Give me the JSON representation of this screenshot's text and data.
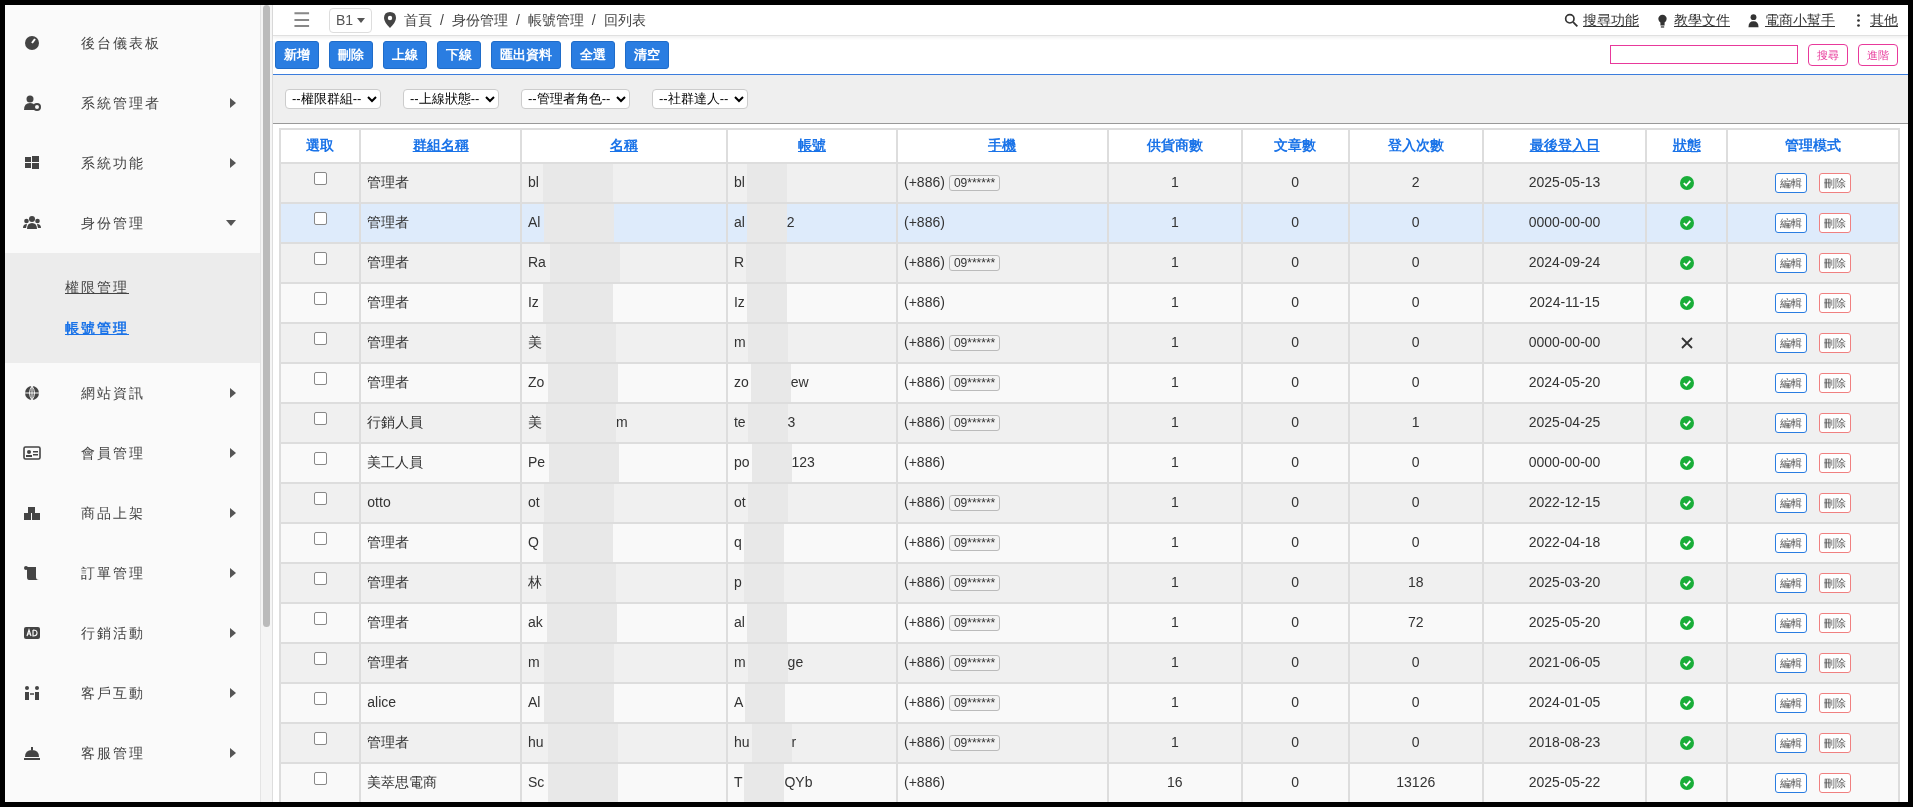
{
  "sidebar": {
    "items": [
      {
        "label": "後台儀表板",
        "expandable": false,
        "expanded": false
      },
      {
        "label": "系統管理者",
        "expandable": true,
        "expanded": false
      },
      {
        "label": "系統功能",
        "expandable": true,
        "expanded": false
      },
      {
        "label": "身份管理",
        "expandable": true,
        "expanded": true,
        "children": [
          {
            "label": "權限管理",
            "selected": false
          },
          {
            "label": "帳號管理",
            "selected": true
          }
        ]
      },
      {
        "label": "網站資訊",
        "expandable": true,
        "expanded": false
      },
      {
        "label": "會員管理",
        "expandable": true,
        "expanded": false
      },
      {
        "label": "商品上架",
        "expandable": true,
        "expanded": false
      },
      {
        "label": "訂單管理",
        "expandable": true,
        "expanded": false
      },
      {
        "label": "行銷活動",
        "expandable": true,
        "expanded": false
      },
      {
        "label": "客戶互動",
        "expandable": true,
        "expanded": false
      },
      {
        "label": "客服管理",
        "expandable": true,
        "expanded": false
      }
    ]
  },
  "topbar": {
    "menu": "☰",
    "store": "B1",
    "breadcrumb": [
      "首頁",
      "身份管理",
      "帳號管理",
      "回列表"
    ],
    "separators": [
      "/",
      "/",
      "/"
    ],
    "links": [
      "搜尋功能",
      "教學文件",
      "電商小幫手",
      "其他"
    ]
  },
  "toolbar": {
    "buttons": [
      "新增",
      "刪除",
      "上線",
      "下線",
      "匯出資料",
      "全選",
      "清空"
    ],
    "search_button": "搜尋",
    "advanced_button": "進階"
  },
  "filters": [
    "--權限群組--",
    "--上線狀態--",
    "--管理者角色--",
    "--社群達人--"
  ],
  "table": {
    "columns": [
      {
        "label": "選取",
        "sortable": false
      },
      {
        "label": "群組名稱",
        "sortable": true
      },
      {
        "label": "名稱",
        "sortable": true
      },
      {
        "label": "帳號",
        "sortable": true
      },
      {
        "label": "手機",
        "sortable": true
      },
      {
        "label": "供貨商數",
        "sortable": false
      },
      {
        "label": "文章數",
        "sortable": false
      },
      {
        "label": "登入次數",
        "sortable": false
      },
      {
        "label": "最後登入日",
        "sortable": true
      },
      {
        "label": "狀態",
        "sortable": true
      },
      {
        "label": "管理模式",
        "sortable": false
      }
    ],
    "rows": [
      {
        "checked": false,
        "highlighted": false,
        "group": "管理者",
        "name": "bl",
        "name_end": "",
        "account": "bl",
        "account_end": "",
        "code": "(+886)",
        "phone": "09******",
        "suppliers": "1",
        "articles": "0",
        "logins": "2",
        "last_login": "2025-05-13",
        "active": true,
        "edit": "編輯",
        "delete": "刪除"
      },
      {
        "checked": false,
        "highlighted": true,
        "group": "管理者",
        "name": "Al",
        "name_end": "",
        "account": "al",
        "account_end": "2",
        "code": "(+886)",
        "suppliers": "1",
        "articles": "0",
        "logins": "0",
        "last_login": "0000-00-00",
        "active": true,
        "edit": "編輯",
        "delete": "刪除"
      },
      {
        "checked": false,
        "highlighted": false,
        "group": "管理者",
        "name": "Ra",
        "name_end": "",
        "account": "R",
        "account_end": "",
        "code": "(+886)",
        "phone": "09******",
        "suppliers": "1",
        "articles": "0",
        "logins": "0",
        "last_login": "2024-09-24",
        "active": true,
        "edit": "編輯",
        "delete": "刪除"
      },
      {
        "checked": false,
        "highlighted": false,
        "group": "管理者",
        "name": "Iz",
        "name_end": "",
        "account": "Iz",
        "account_end": "",
        "code": "(+886)",
        "suppliers": "1",
        "articles": "0",
        "logins": "0",
        "last_login": "2024-11-15",
        "active": true,
        "edit": "編輯",
        "delete": "刪除"
      },
      {
        "checked": false,
        "highlighted": false,
        "group": "管理者",
        "name": "美",
        "name_end": "",
        "account": "m",
        "account_end": "",
        "code": "(+886)",
        "phone": "09******",
        "suppliers": "1",
        "articles": "0",
        "logins": "0",
        "last_login": "0000-00-00",
        "active": false,
        "edit": "編輯",
        "delete": "刪除"
      },
      {
        "checked": false,
        "highlighted": false,
        "group": "管理者",
        "name": "Zo",
        "name_end": "",
        "account": "zo",
        "account_end": "ew",
        "code": "(+886)",
        "phone": "09******",
        "suppliers": "1",
        "articles": "0",
        "logins": "0",
        "last_login": "2024-05-20",
        "active": true,
        "edit": "編輯",
        "delete": "刪除"
      },
      {
        "checked": false,
        "highlighted": false,
        "group": "行銷人員",
        "name": "美",
        "name_end": "m",
        "account": "te",
        "account_end": "3",
        "code": "(+886)",
        "phone": "09******",
        "suppliers": "1",
        "articles": "0",
        "logins": "1",
        "last_login": "2025-04-25",
        "active": true,
        "edit": "編輯",
        "delete": "刪除"
      },
      {
        "checked": false,
        "highlighted": false,
        "group": "美工人員",
        "name": "Pe",
        "name_end": "",
        "account": "po",
        "account_end": "123",
        "code": "(+886)",
        "suppliers": "1",
        "articles": "0",
        "logins": "0",
        "last_login": "0000-00-00",
        "active": true,
        "edit": "編輯",
        "delete": "刪除"
      },
      {
        "checked": false,
        "highlighted": false,
        "group": "otto",
        "name": "ot",
        "name_end": "",
        "account": "ot",
        "account_end": "",
        "code": "(+886)",
        "phone": "09******",
        "suppliers": "1",
        "articles": "0",
        "logins": "0",
        "last_login": "2022-12-15",
        "active": true,
        "edit": "編輯",
        "delete": "刪除"
      },
      {
        "checked": false,
        "highlighted": false,
        "group": "管理者",
        "name": "Q",
        "name_end": "",
        "account": "q",
        "account_end": "",
        "code": "(+886)",
        "phone": "09******",
        "suppliers": "1",
        "articles": "0",
        "logins": "0",
        "last_login": "2022-04-18",
        "active": true,
        "edit": "編輯",
        "delete": "刪除"
      },
      {
        "checked": false,
        "highlighted": false,
        "group": "管理者",
        "name": "林",
        "name_end": "",
        "account": "p",
        "account_end": "",
        "code": "(+886)",
        "phone": "09******",
        "suppliers": "1",
        "articles": "0",
        "logins": "18",
        "last_login": "2025-03-20",
        "active": true,
        "edit": "編輯",
        "delete": "刪除"
      },
      {
        "checked": false,
        "highlighted": false,
        "group": "管理者",
        "name": "ak",
        "name_end": "",
        "account": "al",
        "account_end": "",
        "code": "(+886)",
        "phone": "09******",
        "suppliers": "1",
        "articles": "0",
        "logins": "72",
        "last_login": "2025-05-20",
        "active": true,
        "edit": "編輯",
        "delete": "刪除"
      },
      {
        "checked": false,
        "highlighted": false,
        "group": "管理者",
        "name": "m",
        "name_end": "",
        "account": "m",
        "account_end": "ge",
        "code": "(+886)",
        "phone": "09******",
        "suppliers": "1",
        "articles": "0",
        "logins": "0",
        "last_login": "2021-06-05",
        "active": true,
        "edit": "編輯",
        "delete": "刪除"
      },
      {
        "checked": false,
        "highlighted": false,
        "group": "alice",
        "name": "Al",
        "name_end": "",
        "account": "A",
        "account_end": "",
        "code": "(+886)",
        "phone": "09******",
        "suppliers": "1",
        "articles": "0",
        "logins": "0",
        "last_login": "2024-01-05",
        "active": true,
        "edit": "編輯",
        "delete": "刪除"
      },
      {
        "checked": false,
        "highlighted": false,
        "group": "管理者",
        "name": "hu",
        "name_end": "",
        "account": "hu",
        "account_end": "r",
        "code": "(+886)",
        "phone": "09******",
        "suppliers": "1",
        "articles": "0",
        "logins": "0",
        "last_login": "2018-08-23",
        "active": true,
        "edit": "編輯",
        "delete": "刪除"
      },
      {
        "checked": false,
        "highlighted": false,
        "group": "美萃思電商",
        "name": "Sc",
        "name_end": "",
        "account": "T",
        "account_end": "QYb",
        "code": "(+886)",
        "suppliers": "16",
        "articles": "0",
        "logins": "13126",
        "last_login": "2025-05-22",
        "active": true,
        "edit": "編輯",
        "delete": "刪除"
      }
    ]
  }
}
